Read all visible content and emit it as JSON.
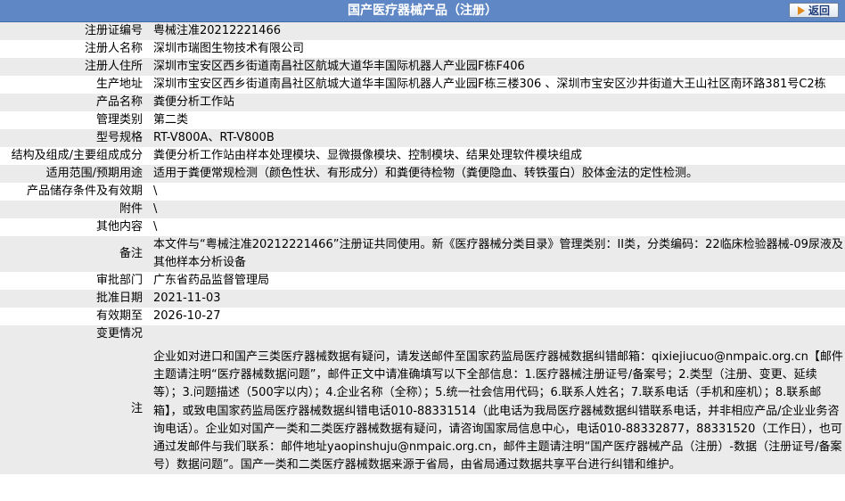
{
  "header": {
    "title": "国产医疗器械产品（注册）",
    "back_label": "返回"
  },
  "rows": [
    {
      "label": "注册证编号",
      "value": "粤械注准20212221466"
    },
    {
      "label": "注册人名称",
      "value": "深圳市瑞图生物技术有限公司"
    },
    {
      "label": "注册人住所",
      "value": "深圳市宝安区西乡街道南昌社区航城大道华丰国际机器人产业园F栋F406"
    },
    {
      "label": "生产地址",
      "value": "深圳市宝安区西乡街道南昌社区航城大道华丰国际机器人产业园F栋三楼306 、深圳市宝安区沙井街道大王山社区南环路381号C2栋"
    },
    {
      "label": "产品名称",
      "value": "粪便分析工作站"
    },
    {
      "label": "管理类别",
      "value": "第二类"
    },
    {
      "label": "型号规格",
      "value": "RT-V800A、RT-V800B"
    },
    {
      "label": "结构及组成/主要组成成分",
      "value": "粪便分析工作站由样本处理模块、显微摄像模块、控制模块、结果处理软件模块组成"
    },
    {
      "label": "适用范围/预期用途",
      "value": "适用于粪便常规检测（颜色性状、有形成分）和粪便待检物（粪便隐血、转铁蛋白）胶体金法的定性检测。"
    },
    {
      "label": "产品储存条件及有效期",
      "value": "\\"
    },
    {
      "label": "附件",
      "value": "\\"
    },
    {
      "label": "其他内容",
      "value": "\\"
    },
    {
      "label": "备注",
      "value": "本文件与“粤械注准20212221466”注册证共同使用。新《医疗器械分类目录》管理类别：II类，分类编码：22临床检验器械-09尿液及其他样本分析设备"
    },
    {
      "label": "审批部门",
      "value": "广东省药品监督管理局"
    },
    {
      "label": "批准日期",
      "value": "2021-11-03"
    },
    {
      "label": "有效期至",
      "value": "2026-10-27"
    },
    {
      "label": "变更情况",
      "value": ""
    }
  ],
  "note": {
    "label": "注",
    "text": "企业如对进口和国产三类医疗器械数据有疑问，请发送邮件至国家药监局医疗器械数据纠错邮箱：qixiejiucuo@nmpaic.org.cn【邮件主题请注明“医疗器械数据问题”，邮件正文中请准确填写以下全部信息：1.医疗器械注册证号/备案号；2.类型（注册、变更、延续等）；3.问题描述（500字以内）；4.企业名称（全称）；5.统一社会信用代码；6.联系人姓名；7.联系电话（手机和座机）；8.联系邮箱】，或致电国家药监局医疗器械数据纠错电话010-88331514（此电话为我局医疗器械数据纠错联系电话，并非相应产品/企业业务咨询电话）。企业如对国产一类和二类医疗器械数据有疑问，请咨询国家局信息中心，电话010-88332877，88331520（工作日），也可通过发邮件与我们联系：邮件地址yaopinshuju@nmpaic.org.cn，邮件主题请注明“国产医疗器械产品（注册）-数据（注册证号/备案号）数据问题”。国产一类和二类医疗器械数据来源于省局，由省局通过数据共享平台进行纠错和维护。"
  }
}
